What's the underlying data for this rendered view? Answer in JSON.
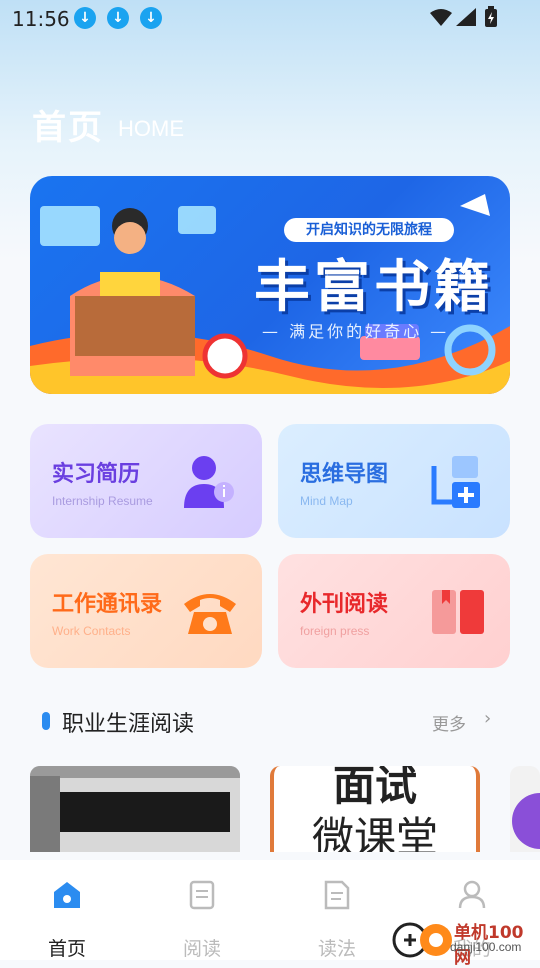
{
  "status_bar": {
    "time": "11:56"
  },
  "header": {
    "title": "首页",
    "subtitle": "HOME"
  },
  "banner": {
    "pill_text": "开启知识的无限旅程",
    "title": "丰富书籍",
    "subtitle": "— 满足你的好奇心 —"
  },
  "cards": [
    {
      "title": "实习简历",
      "subtitle": "Internship Resume",
      "icon": "person-info-icon"
    },
    {
      "title": "思维导图",
      "subtitle": "Mind Map",
      "icon": "mind-map-add-icon"
    },
    {
      "title": "工作通讯录",
      "subtitle": "Work Contacts",
      "icon": "telephone-icon"
    },
    {
      "title": "外刊阅读",
      "subtitle": "foreign press",
      "icon": "book-icon"
    }
  ],
  "section": {
    "title": "职业生涯阅读",
    "more_label": "更多"
  },
  "thumbnails": [
    {
      "text": ""
    },
    {
      "line1": "面试",
      "line2": "微课堂"
    }
  ],
  "bottom_nav": [
    {
      "label": "首页",
      "icon": "home-icon",
      "active": true
    },
    {
      "label": "阅读",
      "icon": "document-icon",
      "active": false
    },
    {
      "label": "读法",
      "icon": "notes-icon",
      "active": false
    },
    {
      "label": "我的",
      "icon": "user-icon",
      "active": false
    }
  ],
  "watermark": {
    "name": "单机100网",
    "url": "danji100.com"
  },
  "colors": {
    "accent": "#2b8cf0",
    "card1": "#7c4dff",
    "card2": "#3a86ff",
    "card3": "#ff7a1a",
    "card4": "#e8282b"
  }
}
